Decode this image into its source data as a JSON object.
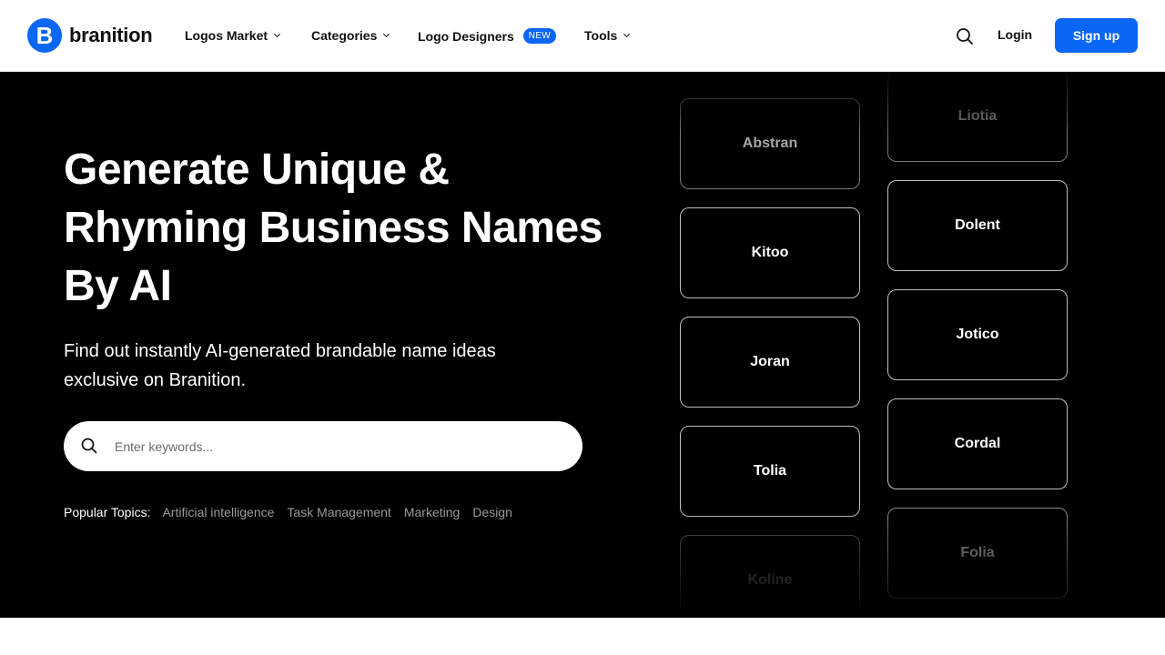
{
  "brand": {
    "name": "branition",
    "mark": "B",
    "color": "#0a66f5"
  },
  "nav": {
    "items": [
      {
        "label": "Logos Market"
      },
      {
        "label": "Categories"
      },
      {
        "label": "Logo Designers",
        "badge": "NEW"
      },
      {
        "label": "Tools"
      }
    ],
    "login_label": "Login",
    "signup_label": "Sign up"
  },
  "hero": {
    "headline": "Generate Unique & Rhyming Business Names By AI",
    "subtitle": "Find out instantly AI-generated brandable name ideas exclusive on Branition.",
    "search_placeholder": "Enter keywords...",
    "search_value": "",
    "popular_label": "Popular Topics:",
    "popular_topics": [
      "Artificial intelligence",
      "Task Management",
      "Marketing",
      "Design"
    ]
  },
  "name_cards": {
    "left_column": [
      "Abstran",
      "Kitoo",
      "Joran",
      "Tolia",
      "Koline"
    ],
    "right_column": [
      "Liotia",
      "Dolent",
      "Jotico",
      "Cordal",
      "Folia"
    ]
  }
}
